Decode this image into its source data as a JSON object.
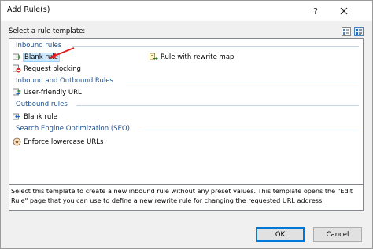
{
  "window": {
    "title": "Add Rule(s)",
    "help_glyph": "?"
  },
  "template_label": "Select a rule template:",
  "groups": [
    {
      "header": "Inbound rules",
      "items": [
        {
          "label": "Blank rule",
          "icon": "blank-rule-icon",
          "selected": true
        },
        {
          "label": "Rule with rewrite map",
          "icon": "rewrite-map-icon"
        },
        {
          "label": "Request blocking",
          "icon": "request-blocking-icon"
        }
      ]
    },
    {
      "header": "Inbound and Outbound Rules",
      "items": [
        {
          "label": "User-friendly URL",
          "icon": "user-friendly-url-icon"
        }
      ]
    },
    {
      "header": "Outbound rules",
      "items": [
        {
          "label": "Blank rule",
          "icon": "blank-rule-icon"
        }
      ]
    },
    {
      "header": "Search Engine Optimization (SEO)",
      "items": [
        {
          "label": "Enforce lowercase URLs",
          "icon": "enforce-lowercase-icon"
        }
      ]
    }
  ],
  "description": "Select this template to create a new inbound rule without any preset values. This template opens the \"Edit Rule\" page that you can use to define a new rewrite rule for changing the requested URL address.",
  "buttons": {
    "ok": "OK",
    "cancel": "Cancel"
  },
  "colors": {
    "group_header": "#1e4e8c",
    "selection": "#cce8ff",
    "arrow": "#e02020"
  }
}
